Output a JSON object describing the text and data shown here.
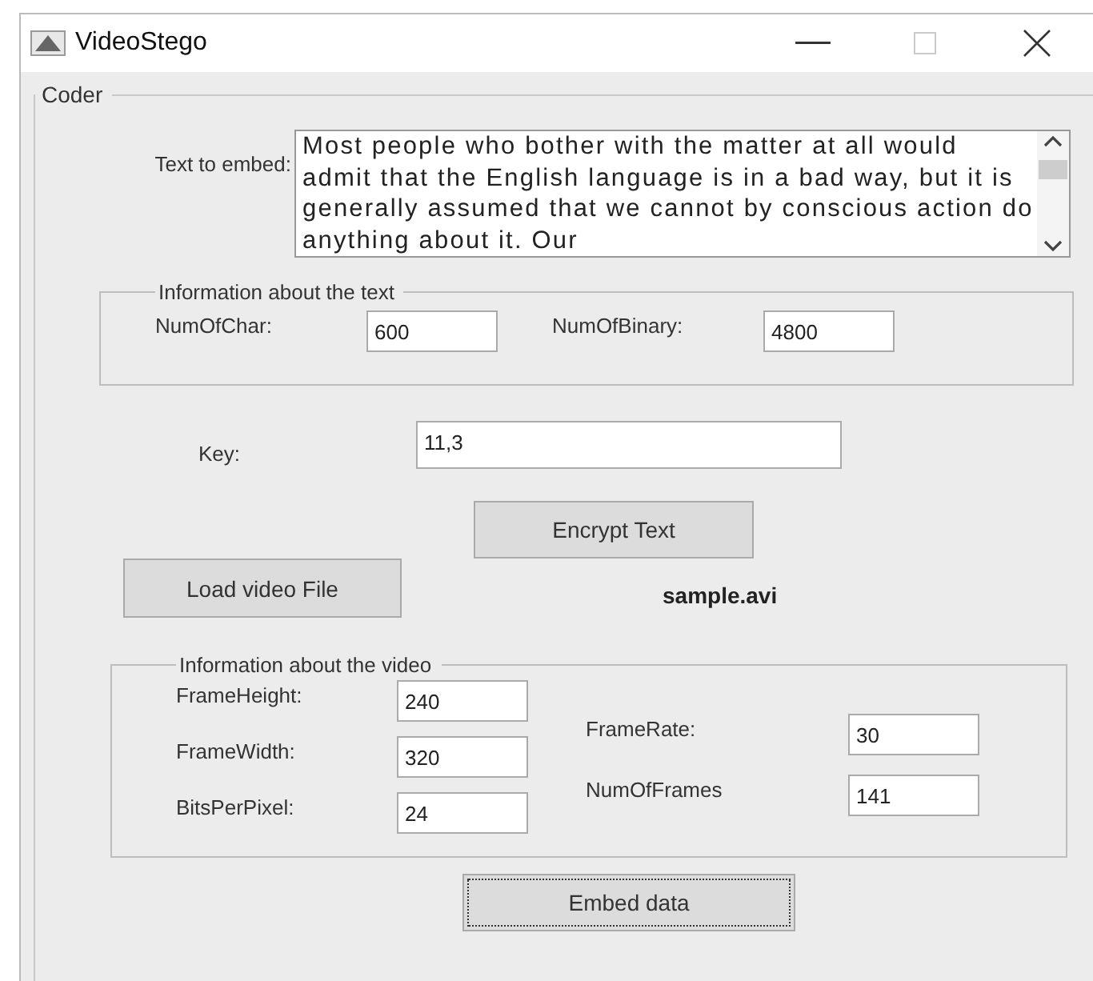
{
  "window": {
    "title": "VideoStego"
  },
  "coder": {
    "title": "Coder",
    "text_to_embed": {
      "label": "Text to embed:",
      "value": "Most people who bother with the matter at all would admit that the English language is in a bad way, but it is generally assumed that we cannot by conscious action do anything about it. Our"
    },
    "text_info": {
      "title": "Information about the text",
      "fields": [
        {
          "label": "NumOfChar:",
          "value": "600"
        },
        {
          "label": "NumOfBinary:",
          "value": "4800"
        }
      ]
    },
    "key": {
      "label": "Key:",
      "value": "11,3"
    },
    "encrypt_button": {
      "label": "Encrypt Text",
      "focused": false
    },
    "load_button": {
      "label": "Load video File",
      "focused": false
    },
    "file_name": "sample.avi",
    "video_info": {
      "title": "Information about the video",
      "left_fields": [
        {
          "label": "FrameHeight:",
          "value": "240"
        },
        {
          "label": "FrameWidth:",
          "value": "320"
        },
        {
          "label": "BitsPerPixel:",
          "value": "24"
        }
      ],
      "right_fields": [
        {
          "label": "FrameRate:",
          "value": "30"
        },
        {
          "label": "NumOfFrames",
          "value": "141"
        }
      ]
    },
    "embed_button": {
      "label": "Embed data",
      "focused": true
    }
  }
}
